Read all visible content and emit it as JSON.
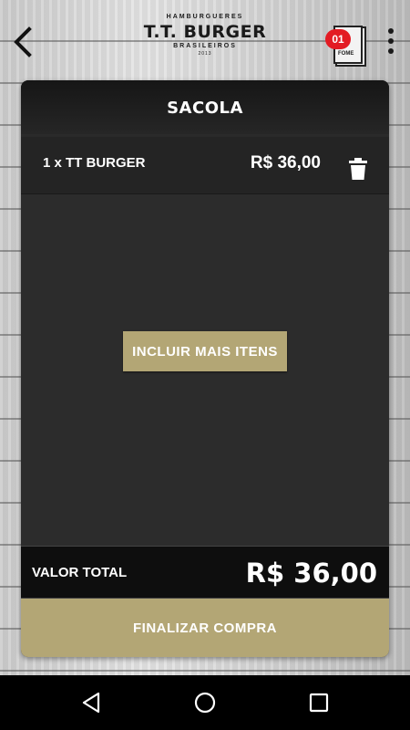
{
  "header": {
    "logo_top": "HAMBURGUERES",
    "logo_name": "T.T. BURGER",
    "logo_bottom": "BRASILEIROS",
    "logo_year": "2013",
    "bag_count": "01",
    "bag_book_text": "DÁ\nde\nFOME",
    "accent_color": "#e31b23"
  },
  "cart": {
    "title": "SACOLA",
    "items": [
      {
        "quantity_name": "1 x TT BURGER",
        "price": "R$ 36,00"
      }
    ],
    "add_more_label": "INCLUIR MAIS ITENS",
    "total_label": "VALOR TOTAL",
    "total_value": "R$ 36,00",
    "checkout_label": "FINALIZAR COMPRA",
    "button_color": "#b3a675"
  },
  "icons": {
    "back": "back-arrow-icon",
    "menu": "more-vert-icon",
    "trash": "trash-icon",
    "nav_back": "nav-back-icon",
    "nav_home": "nav-home-icon",
    "nav_recents": "nav-recents-icon"
  }
}
